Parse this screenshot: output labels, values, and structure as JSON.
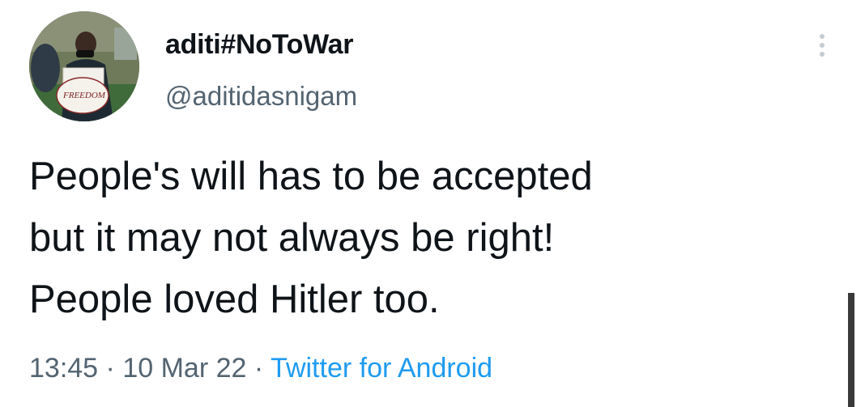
{
  "author": {
    "display_name": "aditi#NoToWar",
    "handle": "@aditidasnigam",
    "avatar_sign_text": "FREEDOM"
  },
  "tweet": {
    "lines": [
      "People's will has to be accepted",
      "but it may not always be right!",
      "People loved Hitler too."
    ],
    "time": "13:45",
    "date": "10 Mar 22",
    "separator": "·",
    "source": "Twitter for Android"
  },
  "icons": {
    "more": "more-vertical-icon"
  },
  "colors": {
    "text": "#0f1419",
    "secondary": "#536471",
    "link": "#1d9bf0"
  }
}
